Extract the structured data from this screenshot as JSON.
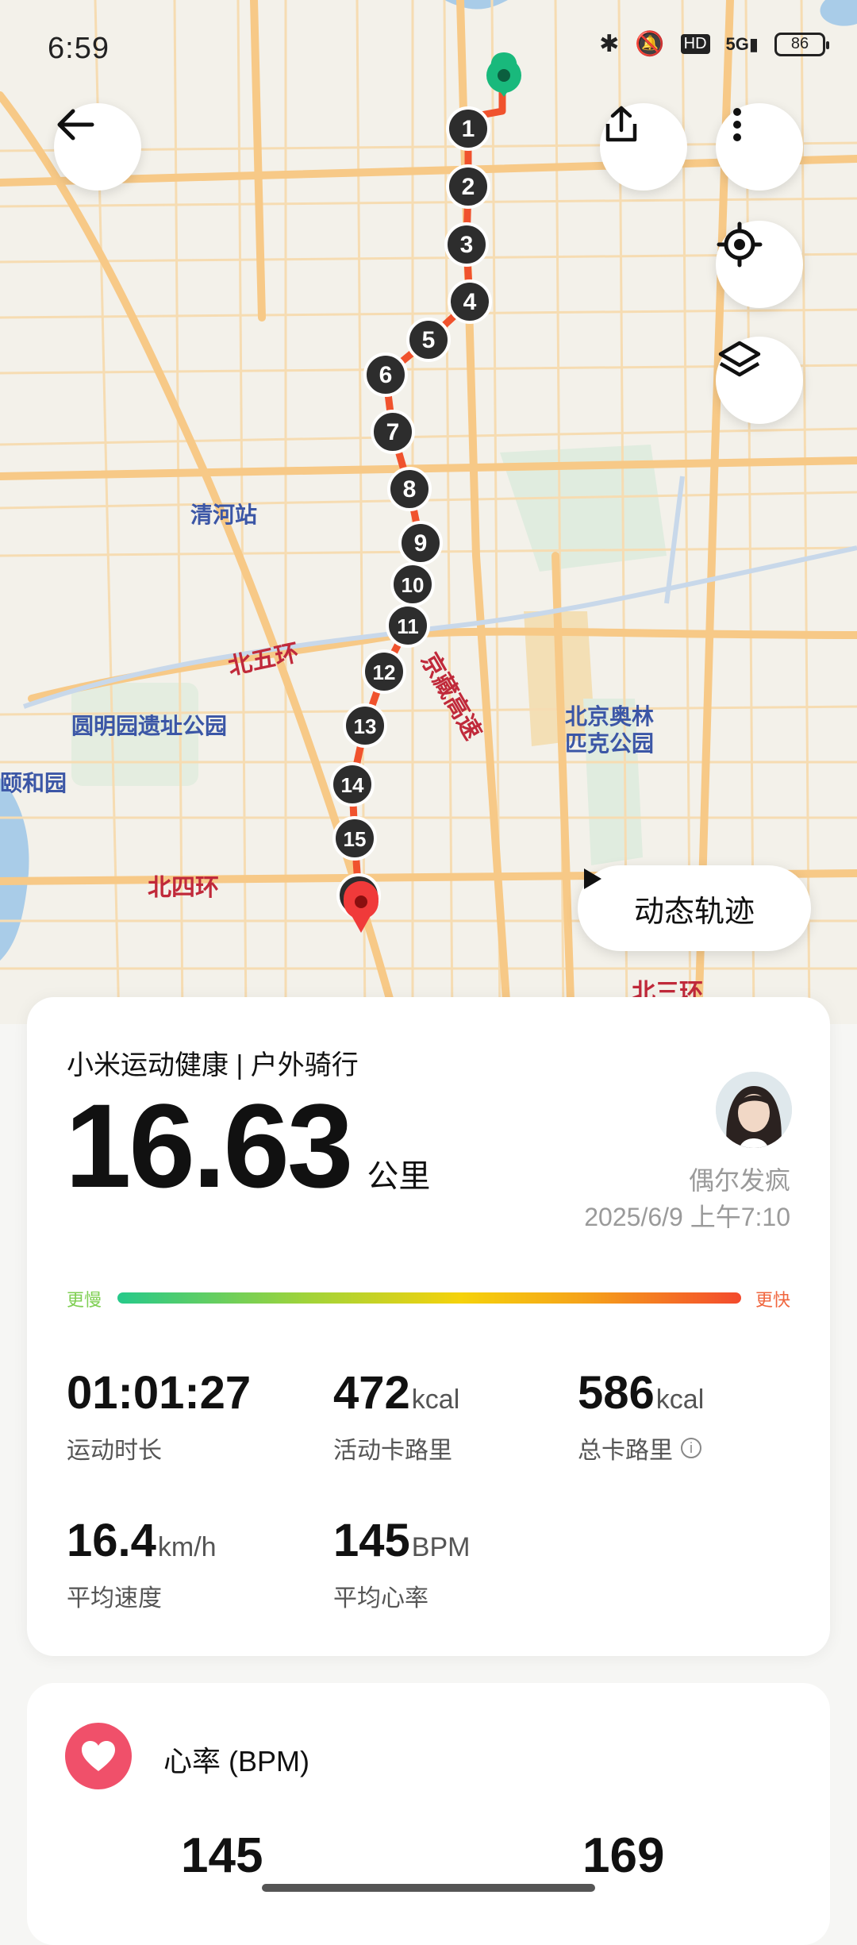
{
  "status_bar": {
    "time": "6:59",
    "network": "5G",
    "hd": "HD",
    "battery": "86"
  },
  "map": {
    "labels": {
      "qinghe": "清河站",
      "north5": "北五环",
      "jingzang": "京藏高速",
      "yuanmingyuan": "圆明园遗址公园",
      "olympic1": "北京奥林",
      "olympic2": "匹克公园",
      "yiheyuan": "颐和园",
      "north4": "北四环",
      "north3": "北三环"
    },
    "km_markers": [
      "1",
      "2",
      "3",
      "4",
      "5",
      "6",
      "7",
      "8",
      "9",
      "10",
      "11",
      "12",
      "13",
      "14",
      "15",
      "16"
    ],
    "route_color": "#f0522d",
    "start_color": "#19b97c",
    "end_color": "#f03a3a"
  },
  "controls": {
    "back_icon": "back-arrow-icon",
    "share_icon": "share-icon",
    "more_icon": "more-vertical-icon",
    "locate_icon": "locate-icon",
    "layers_icon": "layers-icon",
    "play_label": "动态轨迹"
  },
  "summary": {
    "app_line": "小米运动健康 | 户外骑行",
    "distance": "16.63",
    "distance_unit": "公里",
    "user_name": "偶尔发疯",
    "datetime": "2025/6/9 上午7:10",
    "slower_label": "更慢",
    "faster_label": "更快",
    "stats": {
      "duration": {
        "value": "01:01:27",
        "unit": "",
        "label": "运动时长"
      },
      "active_cal": {
        "value": "472",
        "unit": "kcal",
        "label": "活动卡路里"
      },
      "total_cal": {
        "value": "586",
        "unit": "kcal",
        "label": "总卡路里"
      },
      "avg_speed": {
        "value": "16.4",
        "unit": "km/h",
        "label": "平均速度"
      },
      "avg_hr": {
        "value": "145",
        "unit": "BPM",
        "label": "平均心率"
      }
    }
  },
  "heart_rate": {
    "title": "心率 (BPM)",
    "left_value": "145",
    "right_value": "169",
    "accent": "#f0506a"
  }
}
